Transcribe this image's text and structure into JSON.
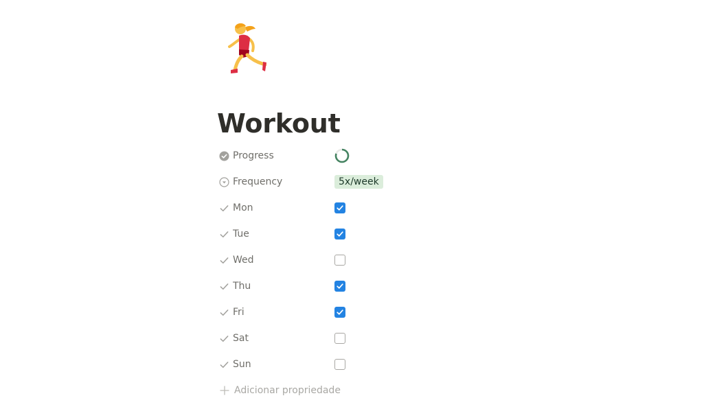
{
  "page": {
    "icon": "woman-running-emoji",
    "title": "Workout"
  },
  "properties": [
    {
      "icon": "status-check-circle-icon",
      "name": "Progress",
      "type": "progress",
      "value": 0.8,
      "ring_color": "#448361",
      "track_color": "#e9e9e7"
    },
    {
      "icon": "select-chevron-circle-icon",
      "name": "Frequency",
      "type": "select",
      "value": "5x/week",
      "tag_color": "#dbeddb"
    },
    {
      "icon": "checkmark-icon",
      "name": "Mon",
      "type": "checkbox",
      "checked": true
    },
    {
      "icon": "checkmark-icon",
      "name": "Tue",
      "type": "checkbox",
      "checked": true
    },
    {
      "icon": "checkmark-icon",
      "name": "Wed",
      "type": "checkbox",
      "checked": false
    },
    {
      "icon": "checkmark-icon",
      "name": "Thu",
      "type": "checkbox",
      "checked": true
    },
    {
      "icon": "checkmark-icon",
      "name": "Fri",
      "type": "checkbox",
      "checked": true
    },
    {
      "icon": "checkmark-icon",
      "name": "Sat",
      "type": "checkbox",
      "checked": false
    },
    {
      "icon": "checkmark-icon",
      "name": "Sun",
      "type": "checkbox",
      "checked": false
    }
  ],
  "add_property": {
    "icon": "plus-icon",
    "label": "Adicionar propriedade"
  },
  "colors": {
    "checkbox_checked": "#2383e2",
    "checkbox_unchecked_border": "#a8a7a3",
    "property_label": "#6f6e69",
    "muted": "#a9a8a4"
  }
}
